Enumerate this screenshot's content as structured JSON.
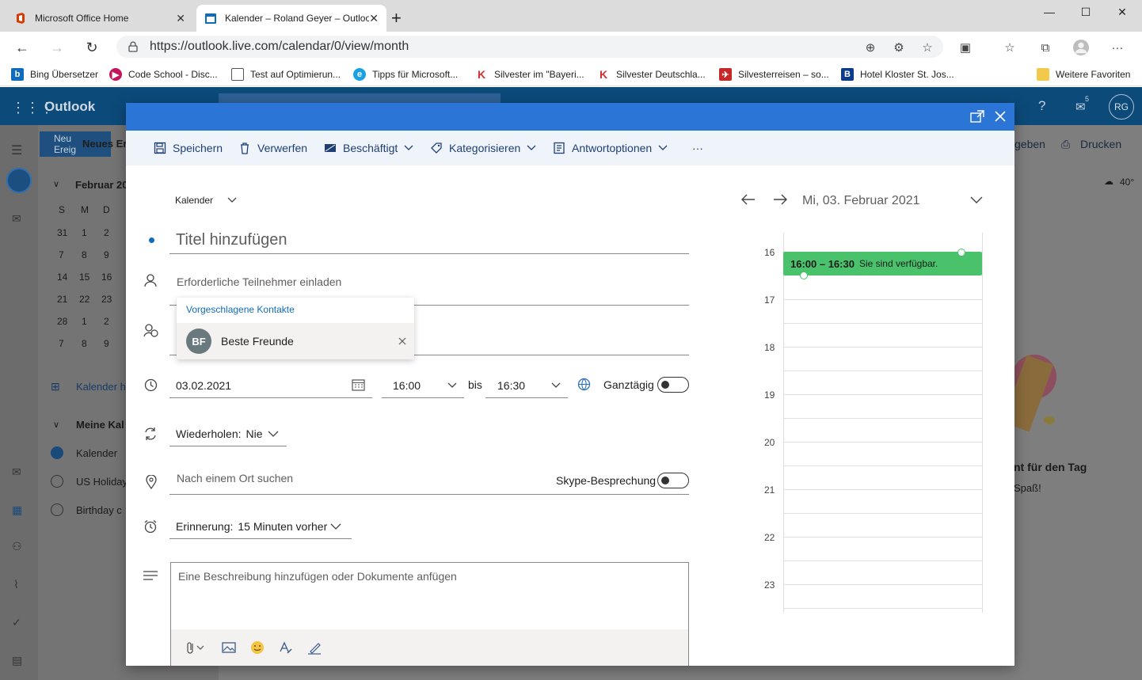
{
  "browser": {
    "tabs": [
      {
        "title": "Microsoft Office Home",
        "active": false
      },
      {
        "title": "Kalender – Roland Geyer – Outlook",
        "active": true
      }
    ],
    "new_tab": "+",
    "url": "https://outlook.live.com/calendar/0/view/month",
    "favorites": [
      {
        "label": "Bing Übersetzer",
        "icon": "bing-icon"
      },
      {
        "label": "Code School - Disc...",
        "icon": "code-school-icon"
      },
      {
        "label": "Test auf Optimierun...",
        "icon": "page-icon"
      },
      {
        "label": "Tipps für Microsoft...",
        "icon": "edge-icon"
      },
      {
        "label": "Silvester im \"Bayeri...",
        "icon": "k-icon"
      },
      {
        "label": "Silvester Deutschla...",
        "icon": "k-icon"
      },
      {
        "label": "Silvesterreisen – so...",
        "icon": "travel-icon"
      },
      {
        "label": "Hotel Kloster St. Jos...",
        "icon": "booking-icon"
      }
    ],
    "favorites_folder": "Weitere Favoriten",
    "colors": {
      "tabbar": "#dcdcdc"
    }
  },
  "outlook": {
    "app_name": "Outlook",
    "avatar_initials": "RG",
    "badge_count": "5",
    "new_event_label_1": "Neu",
    "new_event_label_2": "Ereig",
    "new_label": "Neues Er",
    "month_label": "Februar 20",
    "weekdays": [
      "S",
      "M",
      "D"
    ],
    "weeks": [
      [
        "31",
        "1",
        "2"
      ],
      [
        "7",
        "8",
        "9"
      ],
      [
        "14",
        "15",
        "16"
      ],
      [
        "21",
        "22",
        "23"
      ],
      [
        "28",
        "1",
        "2"
      ],
      [
        "7",
        "8",
        "9"
      ]
    ],
    "add_calendar": "Kalender h",
    "my_calendars": "Meine Kal",
    "calendars": [
      {
        "label": "Kalender",
        "checked": true
      },
      {
        "label": "US Holiday",
        "checked": false
      },
      {
        "label": "Birthday c",
        "checked": false
      }
    ],
    "share_label": "geben",
    "print_label": "Drucken",
    "weather": "40°",
    "promo_title": "nt für den Tag",
    "promo_sub": "Spaß!"
  },
  "modal": {
    "toolbar": {
      "save": "Speichern",
      "discard": "Verwerfen",
      "busy": "Beschäftigt",
      "categorize": "Kategorisieren",
      "response_options": "Antwortoptionen",
      "more": "···"
    },
    "calendar_select": "Kalender",
    "title_placeholder": "Titel hinzufügen",
    "attendees_placeholder": "Erforderliche Teilnehmer einladen",
    "suggestions": {
      "header": "Vorgeschlagene Kontakte",
      "items": [
        {
          "initials": "BF",
          "name": "Beste Freunde"
        }
      ]
    },
    "start_date": "03.02.2021",
    "start_time": "16:00",
    "until": "bis",
    "end_time": "16:30",
    "all_day": "Ganztägig",
    "repeat_label": "Wiederholen:",
    "repeat_value": "Nie",
    "location_placeholder": "Nach einem Ort suchen",
    "skype": "Skype-Besprechung",
    "reminder_label": "Erinnerung:",
    "reminder_value": "15 Minuten vorher",
    "description_placeholder": "Eine Beschreibung hinzufügen oder Dokumente anfügen",
    "day_view": {
      "date": "Mi, 03. Februar 2021",
      "hours": [
        "16",
        "17",
        "18",
        "19",
        "20",
        "21",
        "22",
        "23"
      ],
      "event_time": "16:00 – 16:30",
      "event_status": "Sie sind verfügbar."
    },
    "colors": {
      "header": "#2b75d6",
      "toolbar_bg": "#eff4fa",
      "event": "#4ac26b",
      "link": "#0f6cbd"
    }
  }
}
